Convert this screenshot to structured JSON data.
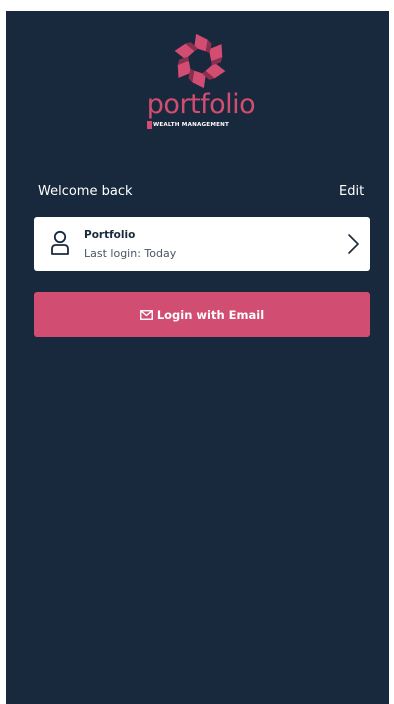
{
  "brand": {
    "name": "portfolio",
    "tagline": "WEALTH MANAGEMENT",
    "accent_color": "#d24d71",
    "background_color": "#18293d",
    "logo_icon": "pinwheel-logo-icon"
  },
  "welcome": {
    "title": "Welcome back",
    "edit_label": "Edit"
  },
  "account": {
    "icon": "user-icon",
    "name": "Portfolio",
    "last_login": "Last login: Today",
    "chevron_icon": "chevron-right-icon"
  },
  "login_button": {
    "icon": "mail-icon",
    "label": "Login with Email",
    "color": "#d14d72"
  }
}
